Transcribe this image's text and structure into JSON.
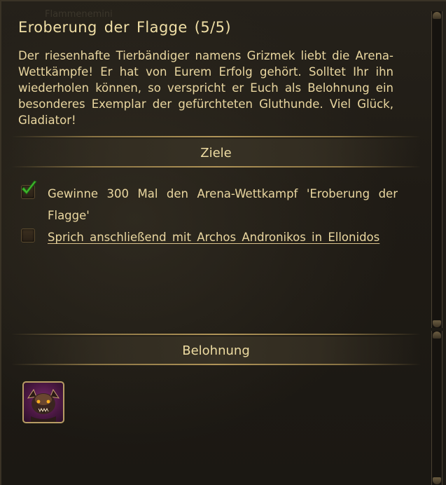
{
  "ghost_header": "Flammenemini",
  "quest": {
    "title": "Eroberung der Flagge (5/5)",
    "description": "Der riesenhafte Tierbändiger namens Grizmek liebt die Arena-Wettkämpfe! Er hat von Eurem Erfolg gehört. Solltet Ihr ihn wiederholen können, so verspricht er Euch als Belohnung ein besonderes Exemplar der gefürchteten Gluthunde. Viel Glück, Gladiator!"
  },
  "objectives": {
    "header": "Ziele",
    "items": [
      {
        "text": "Gewinne 300 Mal den Arena-Wettkampf 'Eroberung der Flagge'",
        "completed": true
      },
      {
        "text": "Sprich anschließend mit Archos Andronikos in Ellonidos",
        "completed": false
      }
    ]
  },
  "rewards": {
    "header": "Belohnung",
    "items": [
      {
        "icon": "fire-hound-mount-icon"
      }
    ]
  },
  "colors": {
    "text": "#ead7a0",
    "divider": "#b09458",
    "checkmark": "#3fb42c",
    "reward_bg": "#7a2c6e"
  }
}
